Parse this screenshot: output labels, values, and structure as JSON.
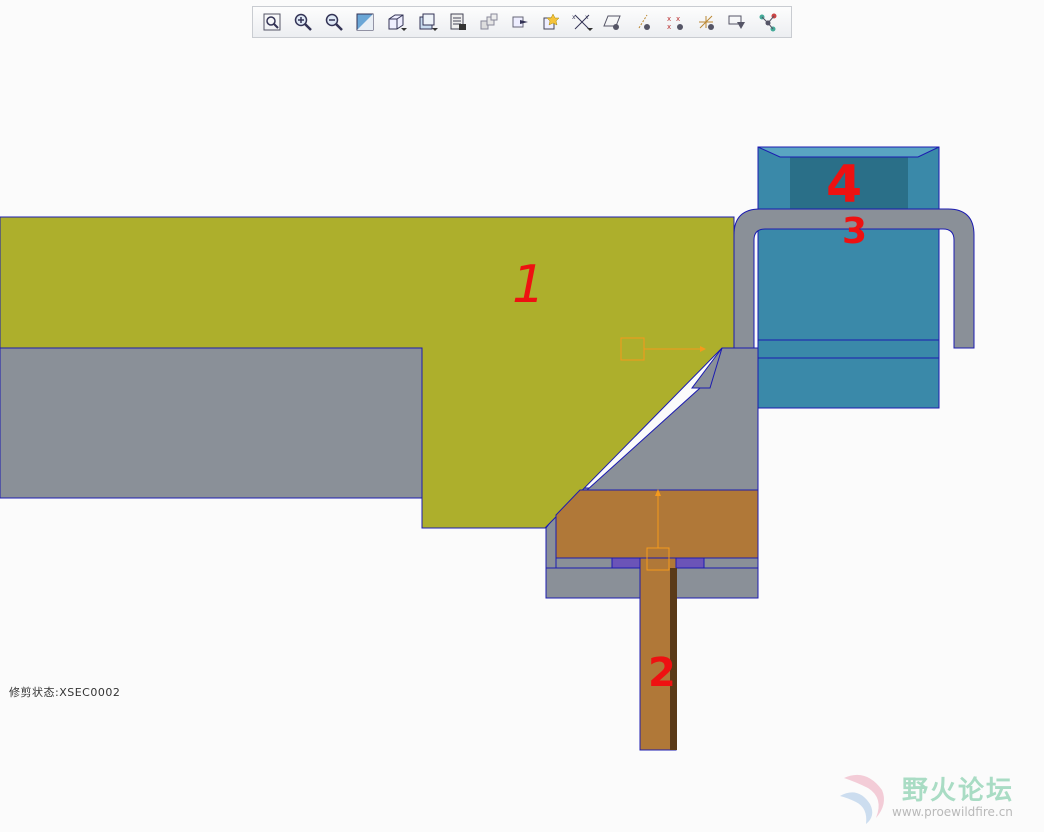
{
  "toolbar": {
    "items": [
      {
        "name": "refit-icon",
        "menu": false
      },
      {
        "name": "zoom-in-icon",
        "menu": false
      },
      {
        "name": "zoom-out-icon",
        "menu": false
      },
      {
        "name": "repaint-icon",
        "menu": false
      },
      {
        "name": "display-style-icon",
        "menu": true
      },
      {
        "name": "saved-orientations-icon",
        "menu": true
      },
      {
        "name": "view-manager-icon",
        "menu": false
      },
      {
        "name": "layers-icon",
        "menu": false
      },
      {
        "name": "spin-center-icon",
        "menu": false
      },
      {
        "name": "annotation-display-icon",
        "menu": false
      },
      {
        "name": "datum-display-icon",
        "menu": true
      },
      {
        "name": "plane-display-icon",
        "menu": false
      },
      {
        "name": "axis-display-icon",
        "menu": false
      },
      {
        "name": "point-display-icon",
        "menu": false
      },
      {
        "name": "csys-display-icon",
        "menu": false
      },
      {
        "name": "view-normal-icon",
        "menu": false
      },
      {
        "name": "appearance-icon",
        "menu": false
      }
    ]
  },
  "status": {
    "clip_state": "修剪状态:XSEC0002"
  },
  "annotations": {
    "label_1": "1",
    "label_2": "2",
    "label_3": "3",
    "label_4": "4"
  },
  "watermark": {
    "title": "野火论坛",
    "url": "www.proewildfire.cn"
  },
  "colors": {
    "part_1": "#adaf2c",
    "part_gray": "#8a9098",
    "part_2": "#b07838",
    "part_blue": "#3a89a9",
    "edge": "#1c1cb0",
    "handle": "#f59a1c",
    "ink": "#ee1111"
  }
}
